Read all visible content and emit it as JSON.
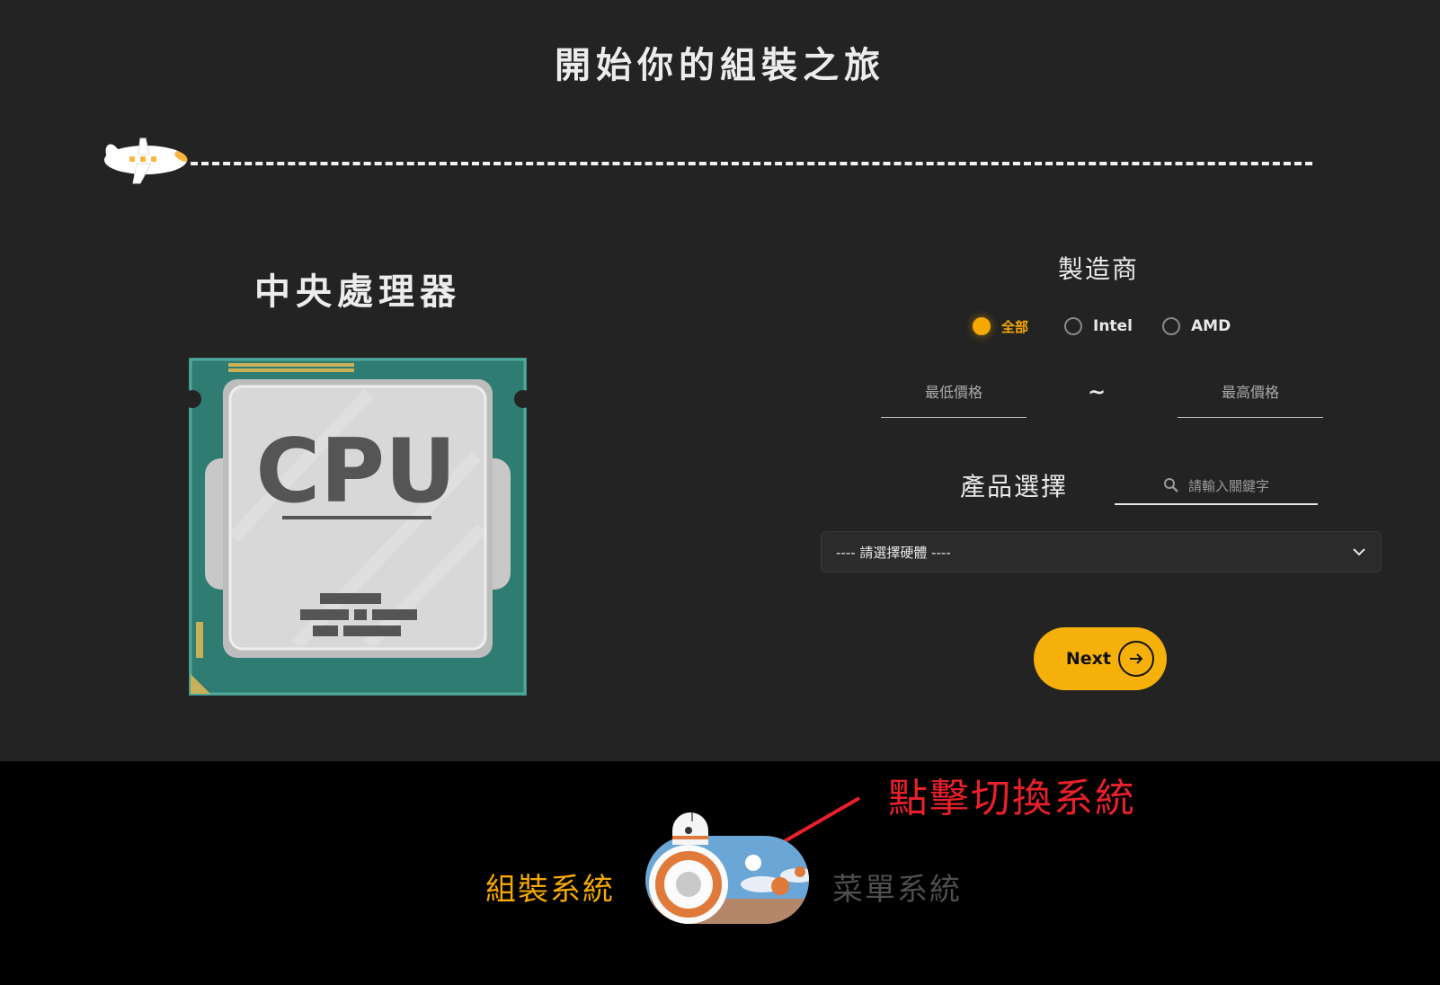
{
  "page": {
    "title": "開始你的組裝之旅"
  },
  "component": {
    "title": "中央處理器",
    "image_text": "CPU"
  },
  "filters": {
    "manufacturer_title": "製造商",
    "manufacturers": [
      {
        "label": "全部",
        "selected": true
      },
      {
        "label": "Intel",
        "selected": false
      },
      {
        "label": "AMD",
        "selected": false
      }
    ],
    "min_price_placeholder": "最低價格",
    "separator": "~",
    "max_price_placeholder": "最高價格"
  },
  "product": {
    "title": "產品選擇",
    "search_placeholder": "請輸入關鍵字",
    "select_value": "---- 請選擇硬體 ----"
  },
  "actions": {
    "next_label": "Next"
  },
  "footer": {
    "annotation": "點擊切換系統",
    "left_label": "組裝系統",
    "right_label": "菜單系統"
  },
  "colors": {
    "accent": "#f5a800",
    "background": "#232323",
    "footer": "#000000",
    "annotation": "#e8202a"
  }
}
